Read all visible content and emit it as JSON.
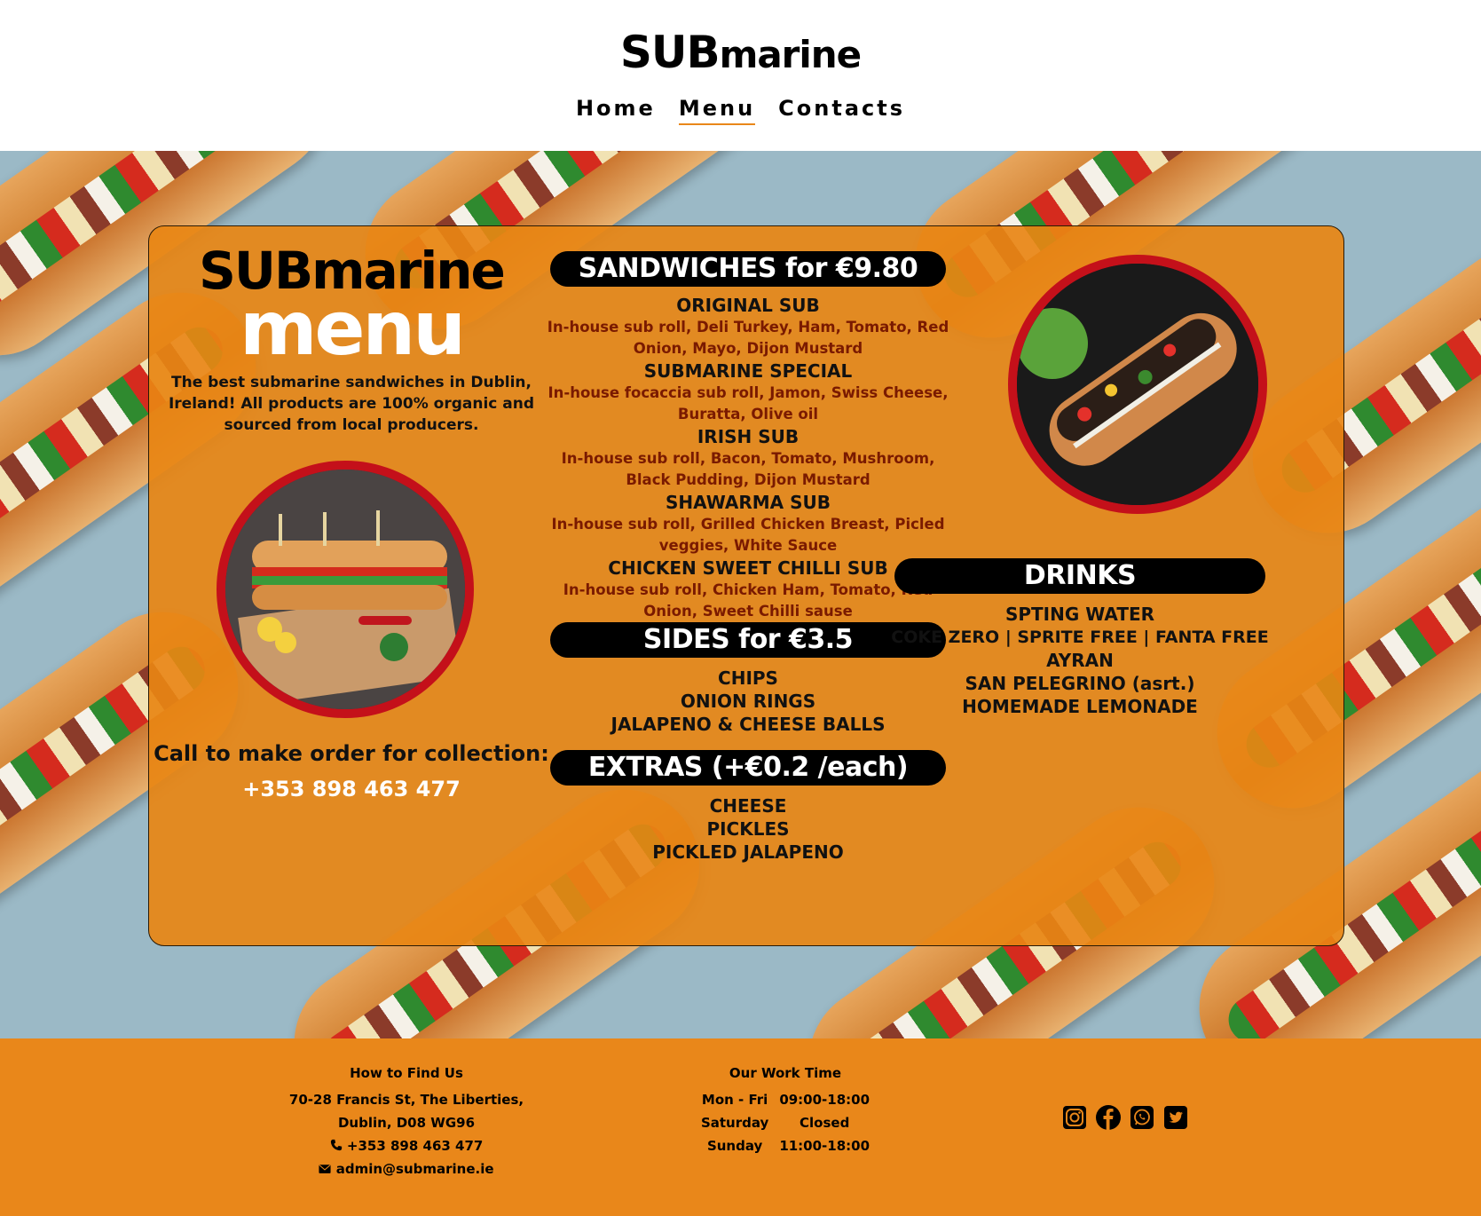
{
  "header": {
    "brand_upper": "SUB",
    "brand_lower": "marine",
    "nav": [
      {
        "label": "Home",
        "active": false
      },
      {
        "label": "Menu",
        "active": true
      },
      {
        "label": "Contacts",
        "active": false
      }
    ]
  },
  "card": {
    "brand_upper": "SUBmarine",
    "brand_title": "menu",
    "tagline": "The best submarine sandwiches in Dublin, Ireland! All products are 100% organic and sourced from local producers.",
    "call_label": "Call to make order for collection:",
    "call_phone": "+353 898 463 477"
  },
  "sandwiches": {
    "heading": "SANDWICHES for €9.80",
    "items": [
      {
        "name": "ORIGINAL SUB",
        "desc": "In-house sub roll, Deli Turkey, Ham, Tomato, Red Onion, Mayo, Dijon Mustard"
      },
      {
        "name": "SUBMARINE SPECIAL",
        "desc": "In-house focaccia sub roll, Jamon, Swiss Cheese, Buratta, Olive oil"
      },
      {
        "name": "IRISH SUB",
        "desc": "In-house sub roll, Bacon, Tomato, Mushroom, Black Pudding, Dijon Mustard"
      },
      {
        "name": "SHAWARMA SUB",
        "desc": "In-house sub roll, Grilled Chicken Breast, Picled veggies, White Sauce"
      },
      {
        "name": "CHICKEN SWEET CHILLI SUB",
        "desc": "In-house sub roll, Chicken Ham, Tomato, Red Onion, Sweet Chilli sause"
      }
    ]
  },
  "sides": {
    "heading": "SIDES for €3.5",
    "items": [
      "CHIPS",
      "ONION RINGS",
      "JALAPENO & CHEESE BALLS"
    ]
  },
  "extras": {
    "heading": "EXTRAS (+€0.2 /each)",
    "items": [
      "CHEESE",
      "PICKLES",
      "PICKLED JALAPENO"
    ]
  },
  "drinks": {
    "heading": "DRINKS",
    "items": [
      "SPTING WATER",
      "COKE ZERO | SPRITE FREE | FANTA FREE",
      "AYRAN",
      "SAN PELEGRINO (asrt.)",
      "HOMEMADE LEMONADE"
    ]
  },
  "footer": {
    "find_us": {
      "heading": "How to Find Us",
      "address_line1": "70-28 Francis St, The Liberties,",
      "address_line2": "Dublin, D08 WG96",
      "phone": "+353 898 463 477",
      "email": "admin@submarine.ie"
    },
    "work_time": {
      "heading": "Our Work Time",
      "rows": [
        {
          "day": "Mon - Fri",
          "hours": "09:00-18:00"
        },
        {
          "day": "Saturday",
          "hours": "Closed"
        },
        {
          "day": "Sunday",
          "hours": "11:00-18:00"
        }
      ]
    },
    "social": [
      "instagram-icon",
      "facebook-icon",
      "whatsapp-icon",
      "twitter-icon"
    ]
  },
  "colors": {
    "accent": "#e9871a",
    "card_orange": "#e88613",
    "photo_ring": "#c4101a",
    "desc_text": "#7a1a00"
  }
}
